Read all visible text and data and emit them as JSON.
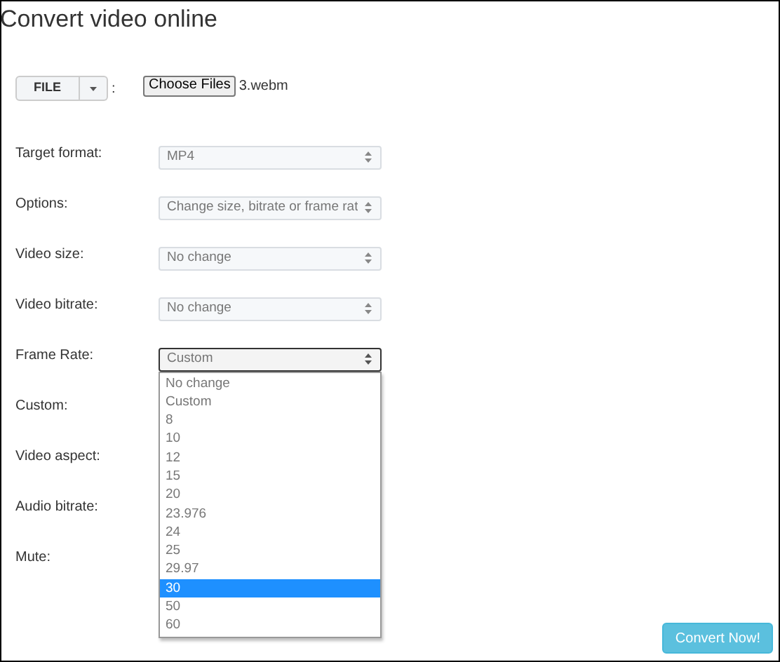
{
  "title": "Convert video online",
  "file_source": {
    "button": "FILE",
    "separator": ":"
  },
  "file_input": {
    "button": "Choose Files",
    "filename": "3.webm"
  },
  "fields": [
    {
      "label": "Target format:",
      "kind": "select",
      "value": "MP4",
      "open": false
    },
    {
      "label": "Options:",
      "kind": "select",
      "value": "Change size, bitrate or frame rat",
      "open": false
    },
    {
      "label": "Video size:",
      "kind": "select",
      "value": "No change",
      "open": false
    },
    {
      "label": "Video bitrate:",
      "kind": "select",
      "value": "No change",
      "open": false
    },
    {
      "label": "Frame Rate:",
      "kind": "select",
      "value": "Custom",
      "open": true,
      "options": [
        {
          "label": "No change",
          "highlighted": false
        },
        {
          "label": "Custom",
          "highlighted": false
        },
        {
          "label": "8",
          "highlighted": false
        },
        {
          "label": "10",
          "highlighted": false
        },
        {
          "label": "12",
          "highlighted": false
        },
        {
          "label": "15",
          "highlighted": false
        },
        {
          "label": "20",
          "highlighted": false
        },
        {
          "label": "23.976",
          "highlighted": false
        },
        {
          "label": "24",
          "highlighted": false
        },
        {
          "label": "25",
          "highlighted": false
        },
        {
          "label": "29.97",
          "highlighted": false
        },
        {
          "label": "30",
          "highlighted": true
        },
        {
          "label": "50",
          "highlighted": false
        },
        {
          "label": "60",
          "highlighted": false
        }
      ]
    },
    {
      "label": "Custom:",
      "kind": "covered"
    },
    {
      "label": "Video aspect:",
      "kind": "covered"
    },
    {
      "label": "Audio bitrate:",
      "kind": "covered"
    },
    {
      "label": "Mute:",
      "kind": "covered"
    }
  ],
  "convert_button": "Convert Now!"
}
